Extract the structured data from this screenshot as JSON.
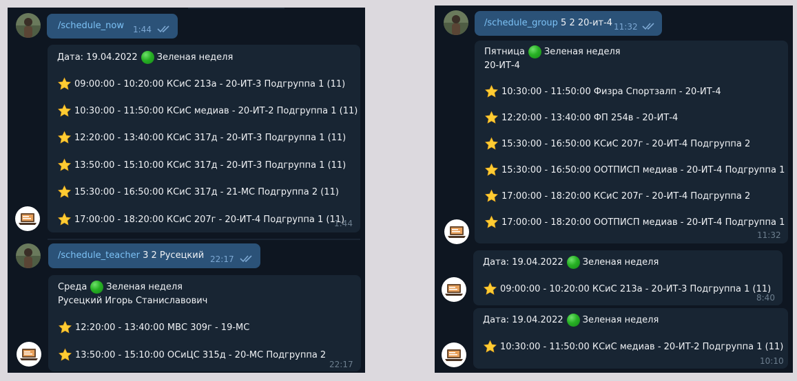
{
  "left": {
    "msg1": {
      "command": "/schedule_now",
      "args": "",
      "time": "1:44"
    },
    "reply1": {
      "date_prefix": "Дата: 19.04.2022",
      "week": "Зеленая неделя",
      "lessons": [
        "09:00:00 - 10:20:00 КСиС 213а - 20-ИТ-3 Подгруппа 1 (11)",
        "10:30:00 - 11:50:00 КСиС медиав - 20-ИТ-2 Подгруппа 1 (11)",
        "12:20:00 - 13:40:00 КСиС 317д - 20-ИТ-3 Подгруппа 1 (11)",
        "13:50:00 - 15:10:00 КСиС 317д - 20-ИТ-3 Подгруппа 1 (11)",
        "15:30:00 - 16:50:00 КСиС 317д - 21-МС Подгруппа 2 (11)",
        "17:00:00 - 18:20:00 КСиС 207г - 20-ИТ-4 Подгруппа 1 (11)"
      ],
      "time": "1:44"
    },
    "msg2": {
      "command": "/schedule_teacher",
      "args": "3 2 Русецкий",
      "time": "22:17"
    },
    "reply2": {
      "day": "Среда",
      "week": "Зеленая неделя",
      "teacher": "Русецкий Игорь Станиславович",
      "lessons": [
        "12:20:00 - 13:40:00 МВС  309г - 19-МС",
        "13:50:00 - 15:10:00 ОСиЦС  315д - 20-МС Подгруппа 2"
      ],
      "time": "22:17"
    }
  },
  "right": {
    "msg1": {
      "command": "/schedule_group",
      "args": "5 2 20-ит-4",
      "time": "11:32"
    },
    "reply1": {
      "day": "Пятница",
      "week": "Зеленая неделя",
      "group": "20-ИТ-4",
      "lessons": [
        "10:30:00 - 11:50:00 Физра Спортзалп - 20-ИТ-4",
        "12:20:00 - 13:40:00 ФП  254в - 20-ИТ-4",
        "15:30:00 - 16:50:00 КСиС 207г - 20-ИТ-4 Подгруппа 2",
        "15:30:00 - 16:50:00 ООТПИСП медиав - 20-ИТ-4 Подгруппа 1",
        "17:00:00 - 18:20:00 КСиС 207г - 20-ИТ-4 Подгруппа 2",
        "17:00:00 - 18:20:00 ООТПИСП медиав - 20-ИТ-4 Подгруппа 1"
      ],
      "time": "11:32"
    },
    "reply2": {
      "date_prefix": "Дата: 19.04.2022",
      "week": "Зеленая неделя",
      "lessons": [
        "09:00:00 - 10:20:00 КСиС 213а - 20-ИТ-3 Подгруппа 1 (11)"
      ],
      "time": "8:40"
    },
    "reply3": {
      "date_prefix": "Дата: 19.04.2022",
      "week": "Зеленая неделя",
      "lessons": [
        "10:30:00 - 11:50:00 КСиС медиав - 20-ИТ-2 Подгруппа 1 (11)"
      ],
      "time": "10:10"
    }
  },
  "icons": {
    "user_avatar": "user-photo-avatar",
    "bot_avatar": "laptop-avatar",
    "read": "double-check-icon",
    "lesson": "star-emoji",
    "week": "green-circle-emoji"
  },
  "colors": {
    "background": "#0e1621",
    "outgoing_bubble": "#2b5278",
    "incoming_bubble": "#182533",
    "command": "#7cc1f5",
    "page": "#dcd9de"
  }
}
